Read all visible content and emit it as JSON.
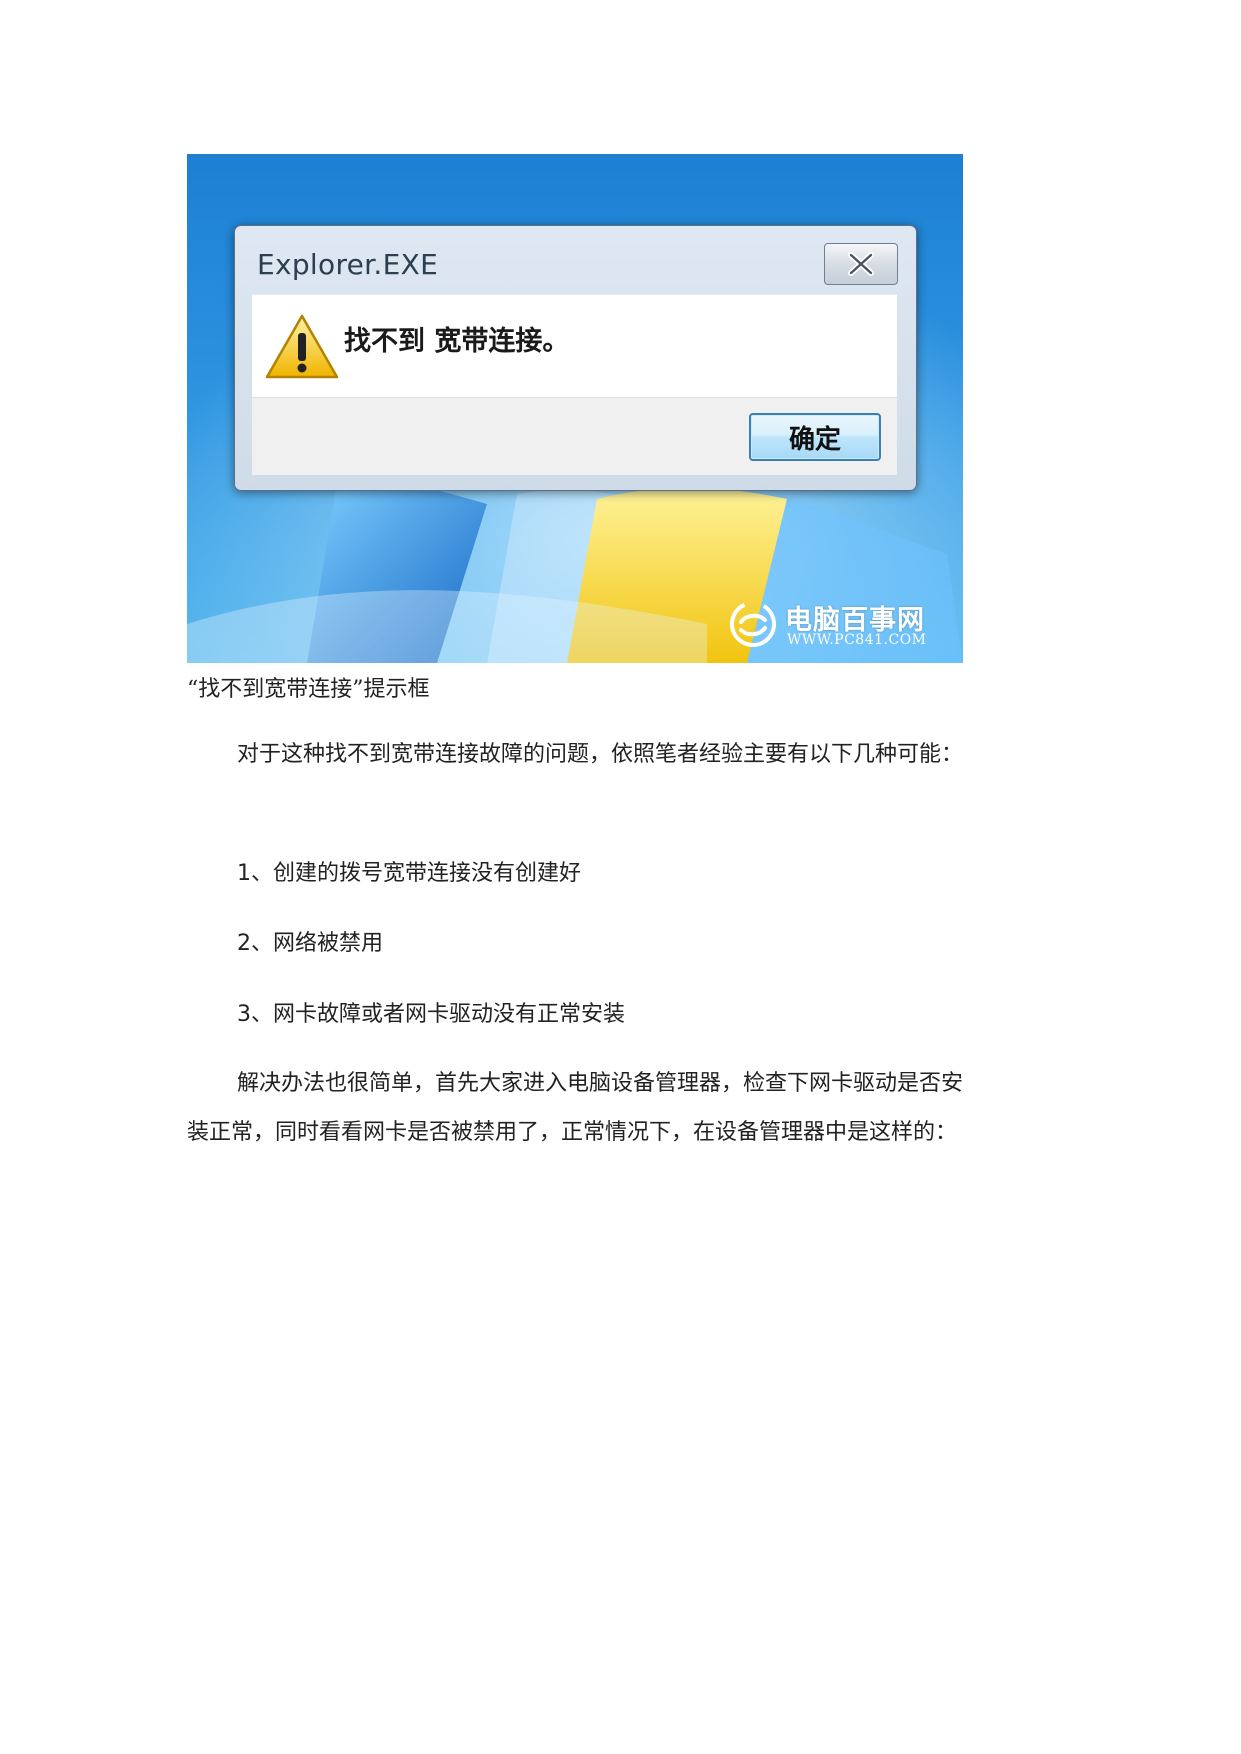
{
  "figure": {
    "dialog": {
      "title": "Explorer.EXE",
      "message": "找不到 宽带连接。",
      "ok_button": "确定",
      "icon": "warning-icon",
      "close_icon": "close-icon"
    },
    "watermark": {
      "name": "电脑百事网",
      "url": "WWW.PC841.COM"
    }
  },
  "caption": "“找不到宽带连接”提示框",
  "intro": "对于这种找不到宽带连接故障的问题，依照笔者经验主要有以下几种可能：",
  "causes": [
    {
      "num": "1",
      "text": "、创建的拨号宽带连接没有创建好"
    },
    {
      "num": "2",
      "text": "、网络被禁用"
    },
    {
      "num": "3",
      "text": "、网卡故障或者网卡驱动没有正常安装"
    }
  ],
  "solution": {
    "line1": "解决办法也很简单，首先大家进入电脑设备管理器，检查下网卡驱动是否安",
    "line2": "装正常，同时看看网卡是否被禁用了，正常情况下，在设备管理器中是这样的："
  }
}
